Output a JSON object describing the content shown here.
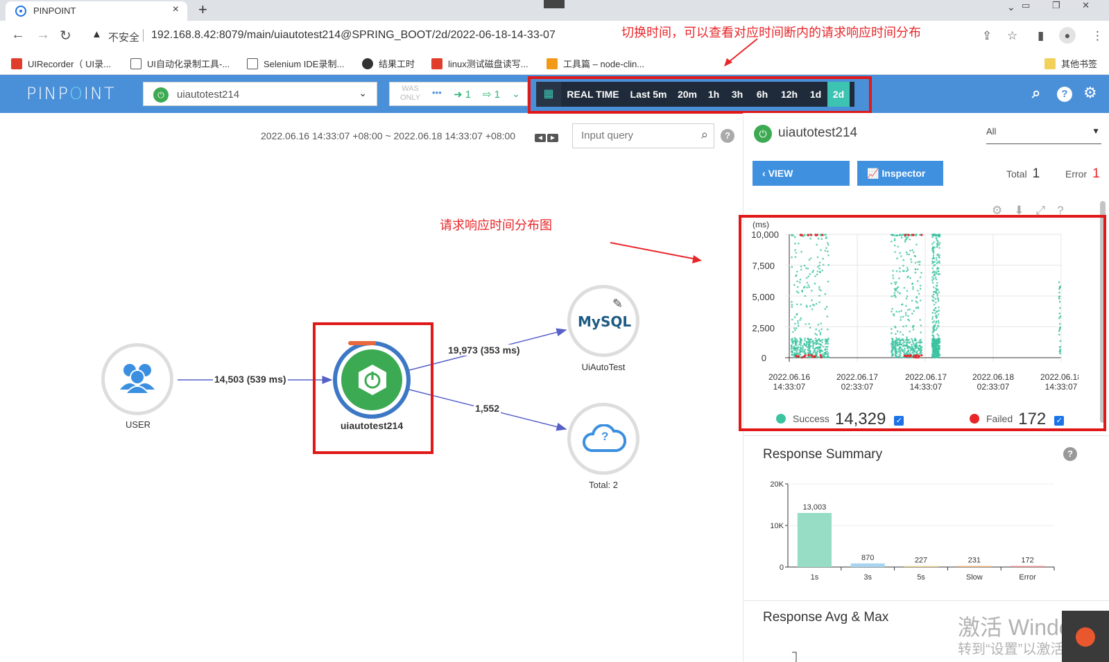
{
  "browser": {
    "tab_title": "PINPOINT",
    "tab_close": "×",
    "new_tab": "+",
    "insecure_label": "不安全",
    "url": "192.168.8.42:8079/main/uiautotest214@SPRING_BOOT/2d/2022-06-18-14-33-07",
    "bookmarks": [
      "UIRecorder（ UI录...",
      "UI自动化录制工具-...",
      "Selenium IDE录制...",
      "结果工时",
      "linux测试磁盘读写...",
      "工具篇 – node-clin..."
    ],
    "other_bookmarks": "其他书签"
  },
  "annotations": {
    "top_note": "切换时间，可以查看对应时间断内的请求响应时间分布",
    "chart_note": "请求响应时间分布图"
  },
  "header": {
    "logo_left": "PINP",
    "logo_o": "O",
    "logo_right": "INT",
    "app_name": "uiautotest214",
    "was_only_line1": "WAS",
    "was_only_line2": "ONLY",
    "inbound_count": "1",
    "outbound_count": "1",
    "time_buttons": [
      "REAL TIME",
      "Last 5m",
      "20m",
      "1h",
      "3h",
      "6h",
      "12h",
      "1d",
      "2d"
    ],
    "active_time": "2d",
    "help_glyph": "?"
  },
  "map": {
    "range": "2022.06.16 14:33:07 +08:00 ~ 2022.06.18 14:33:07 +08:00",
    "query_placeholder": "Input query",
    "help_glyph": "?",
    "nodes": {
      "user": "USER",
      "app": "uiautotest214",
      "mysql_label": "UiAutoTest",
      "mysql_logo": "MySQL",
      "unknown": "Total: 2",
      "unknown_glyph": "?"
    },
    "edges": {
      "user_to_app": "14,503 (539 ms)",
      "app_to_mysql": "19,973 (353 ms)",
      "app_to_unknown": "1,552"
    }
  },
  "right_panel": {
    "app_name": "uiautotest214",
    "agent_filter": "All",
    "view_servers": "VIEW SERVERS",
    "inspector": "Inspector",
    "total_label": "Total",
    "total_value": "1",
    "error_label": "Error",
    "error_value": "1",
    "scatter": {
      "y_unit": "(ms)",
      "y_ticks": [
        "10,000",
        "7,500",
        "5,000",
        "2,500",
        "0"
      ],
      "x_ticks": [
        [
          "2022.06.16",
          "14:33:07"
        ],
        [
          "2022.06.17",
          "02:33:07"
        ],
        [
          "2022.06.17",
          "14:33:07"
        ],
        [
          "2022.06.18",
          "02:33:07"
        ],
        [
          "2022.06.18",
          "14:33:07"
        ]
      ],
      "success_label": "Success",
      "success_count": "14,329",
      "failed_label": "Failed",
      "failed_count": "172",
      "success_color": "#3cc3a0",
      "failed_color": "#e8262a"
    },
    "response_summary_title": "Response Summary",
    "response_avg_title": "Response Avg & Max",
    "help_glyph": "?"
  },
  "chart_data": [
    {
      "type": "bar",
      "title": "Response Summary",
      "categories": [
        "1s",
        "3s",
        "5s",
        "Slow",
        "Error"
      ],
      "values": [
        13003,
        870,
        227,
        231,
        172
      ],
      "value_labels": [
        "13,003",
        "870",
        "227",
        "231",
        "172"
      ],
      "y_tick_labels": [
        "20K",
        "10K",
        "0"
      ],
      "ylim": [
        0,
        20000
      ],
      "colors": [
        "#97dcc5",
        "#a8d4f0",
        "#e6d28f",
        "#e8b27a",
        "#e88a8a"
      ]
    },
    {
      "type": "scatter",
      "xlabel": "",
      "ylabel": "(ms)",
      "ylim": [
        0,
        10000
      ],
      "x_range": [
        "2022.06.16 14:33:07",
        "2022.06.18 14:33:07"
      ],
      "series": [
        {
          "name": "Success",
          "count": 14329
        },
        {
          "name": "Failed",
          "count": 172
        }
      ]
    }
  ],
  "watermark": {
    "line1": "激活 Windows",
    "line2": "转到“设置”以激活 Win"
  }
}
